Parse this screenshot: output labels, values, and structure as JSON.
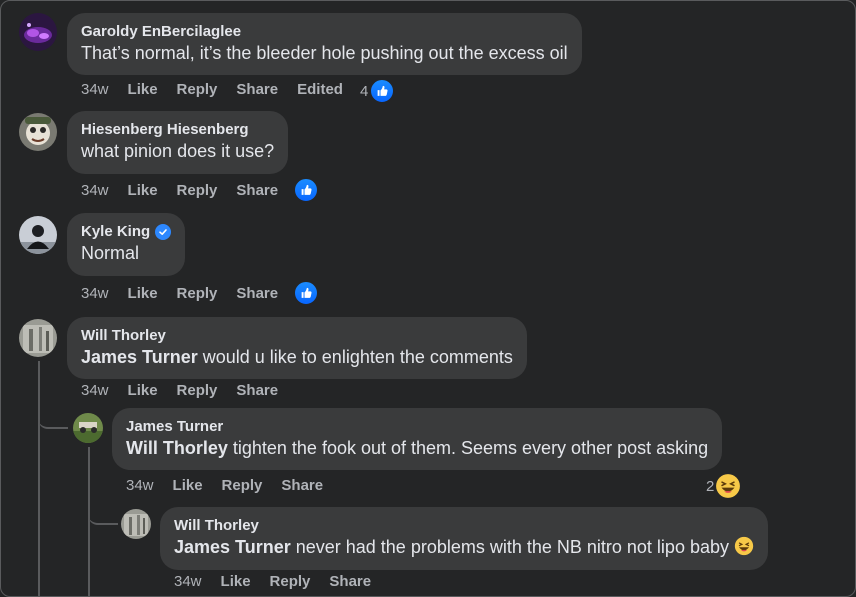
{
  "comments": [
    {
      "author": "Garoldy EnBercilaglee",
      "text": "That’s normal, it’s the bleeder hole pushing out the excess oil",
      "time": "34w",
      "like": "Like",
      "reply": "Reply",
      "share": "Share",
      "edited": "Edited",
      "reaction_count": "4",
      "reaction": "like-icon"
    },
    {
      "author": "Hiesenberg Hiesenberg",
      "text": "what pinion does it use?",
      "time": "34w",
      "like": "Like",
      "reply": "Reply",
      "share": "Share",
      "reaction": "like-icon"
    },
    {
      "author": "Kyle King",
      "verified": true,
      "text": "Normal",
      "time": "34w",
      "like": "Like",
      "reply": "Reply",
      "share": "Share",
      "reaction": "like-icon"
    },
    {
      "author": "Will Thorley",
      "mention": "James Turner",
      "text": "would u like to enlighten the comments",
      "time": "34w",
      "like": "Like",
      "reply": "Reply",
      "share": "Share"
    },
    {
      "author": "James Turner",
      "mention": "Will Thorley",
      "text": "tighten the fook out of them. Seems every other post asking",
      "time": "34w",
      "like": "Like",
      "reply": "Reply",
      "share": "Share",
      "reaction_count": "2",
      "reaction": "haha-icon"
    },
    {
      "author": "Will Thorley",
      "mention": "James Turner",
      "text": "never had the problems with the NB nitro not lipo baby",
      "emoji": "haha-emoji",
      "time": "34w",
      "like": "Like",
      "reply": "Reply",
      "share": "Share"
    }
  ],
  "colors": {
    "background": "#242526",
    "bubble": "#3a3b3c",
    "text": "#e4e6eb",
    "secondary_text": "#b0b3b8",
    "like_blue": "#0866ff",
    "verified_blue": "#2d88ff",
    "haha_yellow": "#f7c948"
  }
}
